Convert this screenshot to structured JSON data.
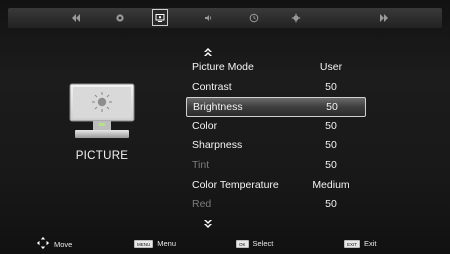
{
  "top_tabs": [
    {
      "icon": "rewind-icon"
    },
    {
      "icon": "settings-dial-icon"
    },
    {
      "icon": "picture-monitor-icon",
      "active": true
    },
    {
      "icon": "speaker-icon"
    },
    {
      "icon": "clock-icon"
    },
    {
      "icon": "gear-icon"
    },
    {
      "icon": "blank-tab"
    },
    {
      "icon": "forward-icon"
    }
  ],
  "section": {
    "label": "PICTURE",
    "icon": "monitor-sun-icon"
  },
  "menu": {
    "items": [
      {
        "label": "Picture Mode",
        "value": "User"
      },
      {
        "label": "Contrast",
        "value": "50"
      },
      {
        "label": "Brightness",
        "value": "50",
        "selected": true
      },
      {
        "label": "Color",
        "value": "50"
      },
      {
        "label": "Sharpness",
        "value": "50"
      },
      {
        "label": "Tint",
        "value": "50",
        "disabled": true
      },
      {
        "label": "Color Temperature",
        "value": "Medium"
      },
      {
        "label": "Red",
        "value": "50",
        "disabled": true
      }
    ]
  },
  "hints": {
    "move": "Move",
    "menu_key": "MENU",
    "menu": "Menu",
    "ok_key": "OK",
    "select": "Select",
    "exit_key": "EXIT",
    "exit": "Exit"
  }
}
